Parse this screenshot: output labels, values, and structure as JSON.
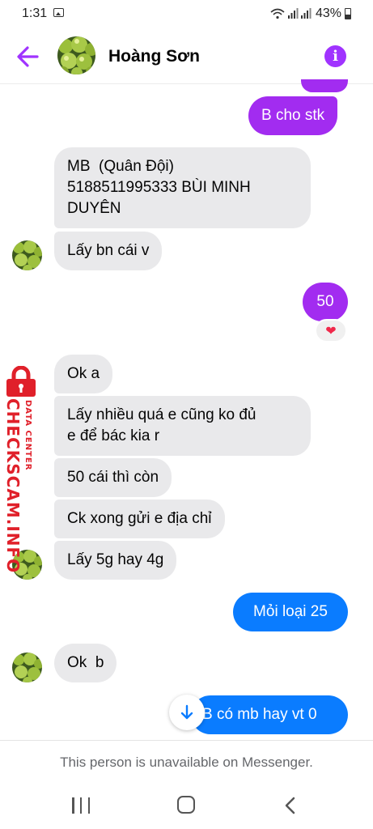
{
  "status_bar": {
    "time": "1:31",
    "battery": "43%"
  },
  "header": {
    "contact_name": "Hoàng Sơn",
    "info_label": "i"
  },
  "messages": [
    {
      "direction": "out",
      "text": "B cho stk"
    },
    {
      "direction": "in",
      "text": "MB  (Quân Đội)\n5188511995333 BÙI MINH\nDUYÊN"
    },
    {
      "direction": "in",
      "text": "Lấy bn cái v"
    },
    {
      "direction": "out",
      "text": "50",
      "reaction": "❤"
    },
    {
      "direction": "in",
      "text": "Ok a"
    },
    {
      "direction": "in",
      "text": "Lấy nhiều quá e cũng ko đủ\ne để bác kia r"
    },
    {
      "direction": "in",
      "text": "50 cái thì còn"
    },
    {
      "direction": "in",
      "text": "Ck xong gửi e địa chỉ"
    },
    {
      "direction": "in",
      "text": "Lấy 5g hay 4g"
    },
    {
      "direction": "out",
      "text": "Mỏi loại 25"
    },
    {
      "direction": "in",
      "text": "Ok  b"
    },
    {
      "direction": "out",
      "text": "B có mb hay vt 0"
    }
  ],
  "watermark": {
    "brand": "CHECKSCAM.INFO",
    "subtitle": "DATA CENTER"
  },
  "footer": {
    "unavailable_text": "This person is unavailable on Messenger."
  },
  "colors": {
    "accent_purple": "#a033ff",
    "bubble_purple": "#a22cf0",
    "bubble_blue": "#0a7cff",
    "incoming_bubble": "#e9e9eb",
    "reaction_heart": "#f0284a",
    "watermark_red": "#e0202a"
  },
  "icons": [
    "picture-icon",
    "wifi-icon",
    "signal-icon",
    "battery-icon",
    "back-arrow-icon",
    "info-icon",
    "heart-icon",
    "arrow-down-icon",
    "lock-icon",
    "recent-apps-icon",
    "home-icon",
    "nav-back-icon"
  ]
}
